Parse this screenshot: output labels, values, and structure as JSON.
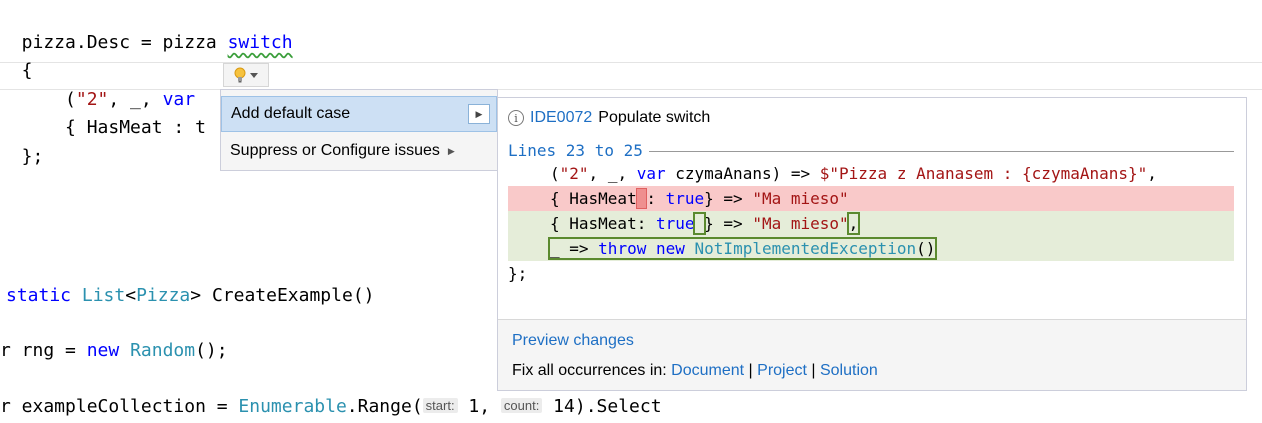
{
  "code": {
    "line1": {
      "a": "  pizza.Desc = pizza ",
      "switch_kw": "switch"
    },
    "line2": "  {",
    "line3": {
      "a": "      (",
      "s1": "\"2\"",
      "b": ", _, ",
      "kw": "var"
    },
    "line4": {
      "a": "      { HasMeat : t"
    },
    "line5": "  };",
    "line6": {
      "kw": "static",
      "sp": " ",
      "type": "List",
      "lt": "<",
      "type2": "Pizza",
      "rest": "> CreateExample()"
    },
    "line7": {
      "a": "r rng = ",
      "kw": "new",
      "sp": " ",
      "type": "Random",
      "rest": "();"
    },
    "line8": {
      "a": "r exampleCollection = ",
      "type": "Enumerable",
      "b": ".Range(",
      "hint1": "start:",
      "c": " 1, ",
      "hint2": "count:",
      "d": " 14).Select"
    }
  },
  "lightbulb": {
    "icon": "lightbulb-icon",
    "dropdown_icon": "chevron-down-icon",
    "color": "#e8a21b"
  },
  "menu": {
    "items": [
      {
        "label": "Add default case",
        "has_submenu": true,
        "selected": true
      },
      {
        "label": "Suppress or Configure issues",
        "has_submenu": true,
        "selected": false
      }
    ],
    "arrow": "▶"
  },
  "preview": {
    "diagnostic_id": "IDE0072",
    "title": "Populate switch",
    "lines_label": "Lines 23 to 25",
    "code": {
      "l1": {
        "a": "(",
        "s1": "\"2\"",
        "b": ", _, ",
        "kw": "var",
        "c": " czymaAnans) => ",
        "s2": "$\"Pizza z Ananasem : {czymaAnans}\"",
        "d": ","
      },
      "l2": {
        "a": "{ HasMeat",
        "hl": " ",
        "b": ": ",
        "kw": "true",
        "c": "} => ",
        "s": "\"Ma mieso\""
      },
      "l3": {
        "a": "{ HasMeat: ",
        "kw": "true",
        "hl": " ",
        "b": "} => ",
        "s": "\"Ma mieso\"",
        "comma": ","
      },
      "l4": {
        "a": "_ => ",
        "kw1": "throw",
        "sp": " ",
        "kw2": "new",
        "sp2": " ",
        "type": "NotImplementedException",
        "b": "()"
      },
      "l5": "};"
    },
    "preview_changes_link": "Preview changes",
    "fix_all": {
      "label": "Fix all occurrences in: ",
      "document": "Document",
      "sep1": " | ",
      "project": "Project",
      "sep2": " | ",
      "solution": "Solution"
    }
  },
  "colors": {
    "keyword": "#0000ff",
    "string": "#a31515",
    "type": "#2b91af",
    "removed_bg": "#f9c9c9",
    "added_bg": "#e5edd9",
    "link": "#1e6fc4"
  }
}
